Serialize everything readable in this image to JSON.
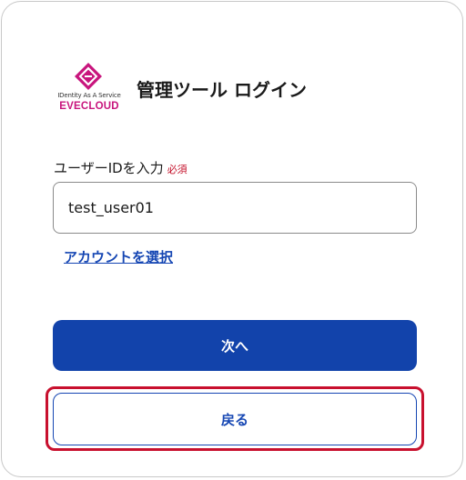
{
  "header": {
    "logo_tagline": "IDentity As A Service",
    "logo_brand": "EVECLOUD",
    "title": "管理ツール ログイン"
  },
  "form": {
    "label": "ユーザーIDを入力",
    "required_badge": "必須",
    "user_id_value": "test_user01",
    "select_account_link": "アカウントを選択"
  },
  "actions": {
    "next_label": "次へ",
    "back_label": "戻る"
  },
  "colors": {
    "brand": "#c8157d",
    "primary": "#1243ab",
    "link": "#1546b3",
    "required": "#c4102a",
    "highlight": "#c8102e"
  }
}
